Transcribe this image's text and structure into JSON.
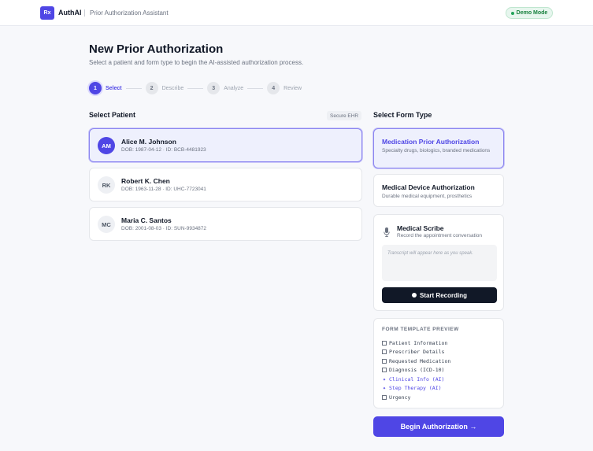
{
  "header": {
    "logo": "Rx",
    "brand": "AuthAI",
    "app_title": "Prior Authorization Assistant",
    "demo_badge": "Demo Mode"
  },
  "page": {
    "title": "New Prior Authorization",
    "subtitle": "Select a patient and form type to begin the AI-assisted authorization process."
  },
  "steps": [
    {
      "num": "1",
      "label": "Select",
      "active": true
    },
    {
      "num": "2",
      "label": "Describe",
      "active": false
    },
    {
      "num": "3",
      "label": "Analyze",
      "active": false
    },
    {
      "num": "4",
      "label": "Review",
      "active": false
    }
  ],
  "patients_section": {
    "title": "Select Patient",
    "badge": "Secure EHR",
    "patients": [
      {
        "initials": "AM",
        "name": "Alice M. Johnson",
        "meta": "DOB: 1987-04-12 · ID: BCB-4481923",
        "selected": true
      },
      {
        "initials": "RK",
        "name": "Robert K. Chen",
        "meta": "DOB: 1963-11-28 · ID: UHC-7723041",
        "selected": false
      },
      {
        "initials": "MC",
        "name": "Maria C. Santos",
        "meta": "DOB: 2001-08-03 · ID: SUN-9934872",
        "selected": false
      }
    ]
  },
  "form_section": {
    "title": "Select Form Type",
    "options": [
      {
        "title": "Medication Prior Authorization",
        "desc": "Specialty drugs, biologics, branded medications",
        "selected": true
      },
      {
        "title": "Medical Device Authorization",
        "desc": "Durable medical equipment, prosthetics",
        "selected": false
      }
    ]
  },
  "scribe": {
    "icon": "microphone-icon",
    "title": "Medical Scribe",
    "subtitle": "Record the appointment conversation",
    "placeholder": "Transcript will appear here as you speak.",
    "button": "Start Recording"
  },
  "template": {
    "title": "FORM TEMPLATE PREVIEW",
    "items": [
      {
        "label": "Patient Information",
        "ai": false
      },
      {
        "label": "Prescriber Details",
        "ai": false
      },
      {
        "label": "Requested Medication",
        "ai": false
      },
      {
        "label": "Diagnosis (ICD-10)",
        "ai": false
      },
      {
        "label": "Clinical Info (AI)",
        "ai": true
      },
      {
        "label": "Step Therapy (AI)",
        "ai": true
      },
      {
        "label": "Urgency",
        "ai": false
      }
    ]
  },
  "begin_button": "Begin Authorization →",
  "colors": {
    "accent": "#4f46e5",
    "dark": "#111827",
    "success": "#17803d"
  }
}
